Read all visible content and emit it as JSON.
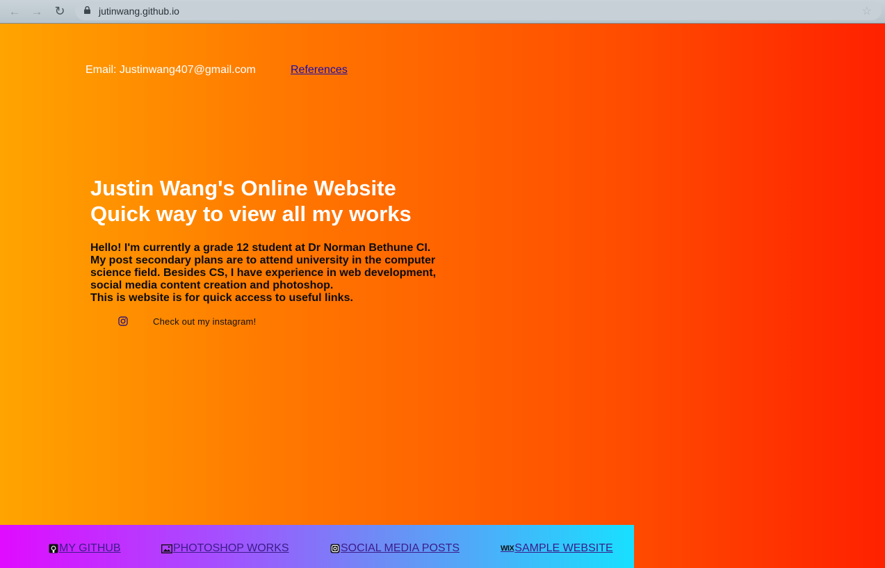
{
  "browser": {
    "url": "jutinwang.github.io"
  },
  "header": {
    "email": "Email: Justinwang407@gmail.com",
    "references": "References"
  },
  "hero": {
    "title_line1": "Justin Wang's Online Website",
    "title_line2": "Quick way to view all my works"
  },
  "intro": {
    "lines": [
      "Hello! I'm currently a grade 12 student at Dr Norman Bethune CI.",
      "My post secondary plans are to attend university in the computer",
      "science field. Besides CS, I have experience in web development,",
      "social media content creation and photoshop.",
      "This is website is for quick access to useful links."
    ]
  },
  "instagram": {
    "label": "Check out my instagram!"
  },
  "footer": {
    "links": [
      {
        "label": "MY GITHUB"
      },
      {
        "label": "PHOTOSHOP WORKS"
      },
      {
        "label": "SOCIAL MEDIA POSTS"
      },
      {
        "label": "SAMPLE WEBSITE",
        "icon_text": "WIX"
      }
    ]
  },
  "colors": {
    "page_gradient_start": "#ffa400",
    "page_gradient_end": "#ff2100",
    "footer_gradient_start": "#e00bff",
    "footer_gradient_end": "#18e0ff",
    "link": "#1a0dab"
  }
}
